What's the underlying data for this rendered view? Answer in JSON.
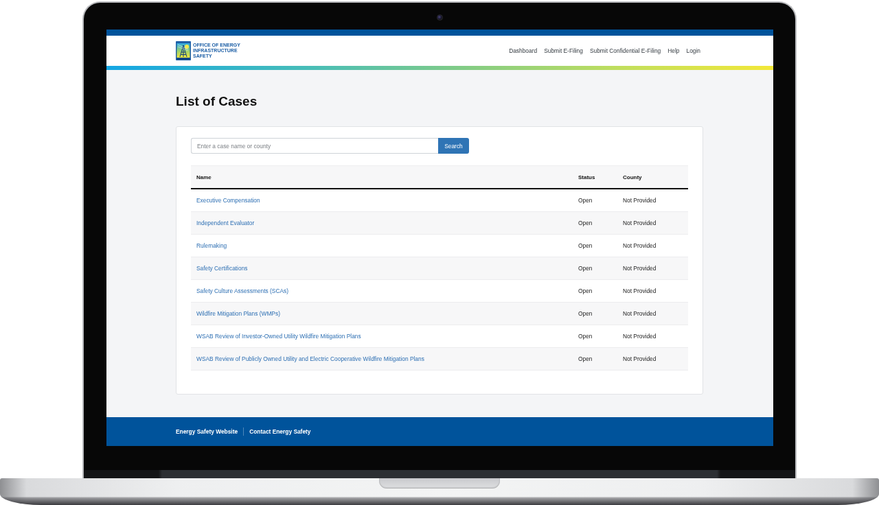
{
  "header": {
    "logo_lines": [
      "OFFICE OF ENERGY",
      "INFRASTRUCTURE",
      "SAFETY"
    ],
    "nav": [
      {
        "label": "Dashboard"
      },
      {
        "label": "Submit E-Filing"
      },
      {
        "label": "Submit Confidential E-Filing"
      },
      {
        "label": "Help"
      },
      {
        "label": "Login"
      }
    ]
  },
  "page_title": "List of Cases",
  "search": {
    "placeholder": "Enter a case name or county",
    "button": "Search"
  },
  "table": {
    "columns": [
      "Name",
      "Status",
      "County"
    ],
    "rows": [
      {
        "name": "Executive Compensation",
        "status": "Open",
        "county": "Not Provided"
      },
      {
        "name": "Independent Evaluator",
        "status": "Open",
        "county": "Not Provided"
      },
      {
        "name": "Rulemaking",
        "status": "Open",
        "county": "Not Provided"
      },
      {
        "name": "Safety Certifications",
        "status": "Open",
        "county": "Not Provided"
      },
      {
        "name": "Safety Culture Assessments (SCAs)",
        "status": "Open",
        "county": "Not Provided"
      },
      {
        "name": "Wildfire Mitigation Plans (WMPs)",
        "status": "Open",
        "county": "Not Provided"
      },
      {
        "name": "WSAB Review of Investor-Owned Utility Wildfire Mitigation Plans",
        "status": "Open",
        "county": "Not Provided"
      },
      {
        "name": "WSAB Review of Publicly Owned Utility and Electric Cooperative Wildfire Mitigation Plans",
        "status": "Open",
        "county": "Not Provided"
      }
    ]
  },
  "footer": {
    "links": [
      "Energy Safety Website",
      "Contact Energy Safety"
    ]
  }
}
